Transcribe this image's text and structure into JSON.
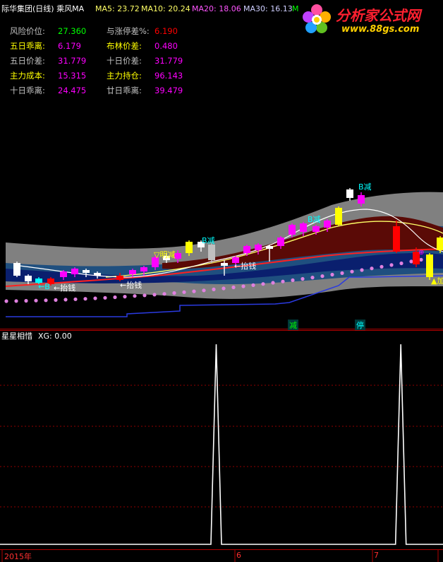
{
  "colors": {
    "bg": "#000000",
    "red": "#ff0000",
    "white": "#ffffff",
    "yellow": "#ffff00",
    "magenta": "#ff00ff",
    "cyan": "#00ffff",
    "green": "#00ff00",
    "blue": "#0000ff",
    "gray": "#808080"
  },
  "header": {
    "title": "际华集团(日线) 乘风MA",
    "ma5": "MA5: 23.72",
    "ma10": "MA10: 20.24",
    "ma20": "MA20: 18.06",
    "ma30": "MA30: 16.13",
    "ma_cut": "M"
  },
  "logo": {
    "name": "分析家公式网",
    "url": "www.88gs.com",
    "icon": "flower-icon"
  },
  "stats": [
    {
      "label": "风险价位:",
      "value": "27.360",
      "lc": "#c0c0c0",
      "vc": "#00ff00"
    },
    {
      "label": "与涨停差%:",
      "value": "6.190",
      "lc": "#c0c0c0",
      "vc": "#ff0000"
    },
    {
      "label": "五日乖离:",
      "value": "6.179",
      "lc": "#ffff00",
      "vc": "#ff00ff"
    },
    {
      "label": "布林价差:",
      "value": "0.480",
      "lc": "#ffff00",
      "vc": "#ff00ff"
    },
    {
      "label": "五日价差:",
      "value": "31.779",
      "lc": "#c0c0c0",
      "vc": "#ff00ff"
    },
    {
      "label": "十日价差:",
      "value": "31.779",
      "lc": "#c0c0c0",
      "vc": "#ff00ff"
    },
    {
      "label": "主力成本:",
      "value": "15.315",
      "lc": "#ffff00",
      "vc": "#ff00ff"
    },
    {
      "label": "主力持仓:",
      "value": "96.143",
      "lc": "#ffff00",
      "vc": "#ff00ff"
    },
    {
      "label": "十日乖离:",
      "value": "24.475",
      "lc": "#c0c0c0",
      "vc": "#ff00ff"
    },
    {
      "label": "廿日乖离:",
      "value": "39.479",
      "lc": "#c0c0c0",
      "vc": "#ff00ff"
    }
  ],
  "annotations": {
    "b1": "B减",
    "b2": "B减",
    "b3": "B减",
    "b4": "B减",
    "mingjian": "▽明减",
    "jian_bottom": "减",
    "ting_bottom": "停",
    "qian1": "←抬钱",
    "qian2": "←抬钱",
    "qian3": "←抬钱",
    "b_left": "←B",
    "right_mark": "▲加",
    "right_circle": "⊕"
  },
  "sub": {
    "title": "星星相惜",
    "xg": "XG: 0.00"
  },
  "axis": {
    "labels": [
      "2015年",
      "6",
      "7"
    ]
  },
  "chart_data": {
    "type": "line",
    "title": "星星相惜",
    "series": [
      {
        "name": "XG",
        "values": [
          0,
          0,
          0,
          0,
          0,
          0,
          0,
          0,
          0,
          0,
          0,
          0,
          0,
          0,
          0,
          0,
          0,
          0,
          0,
          0,
          0,
          0,
          0,
          0,
          0,
          0,
          0,
          0,
          0,
          0,
          0,
          0,
          0,
          0,
          0,
          0,
          0,
          0,
          0,
          0,
          0,
          1,
          0,
          0,
          0,
          0,
          0,
          0,
          0,
          0,
          0,
          0,
          0,
          0,
          0,
          0,
          0,
          0,
          0,
          0,
          0,
          0,
          0,
          0,
          0,
          0,
          0,
          0,
          0,
          0,
          0,
          0,
          0,
          0,
          0,
          0,
          1,
          0,
          0,
          0,
          0,
          0,
          0,
          0,
          0
        ]
      }
    ],
    "ylim": [
      0,
      1
    ],
    "grid": true,
    "x_labels": [
      "2015年",
      "6",
      "7"
    ]
  }
}
